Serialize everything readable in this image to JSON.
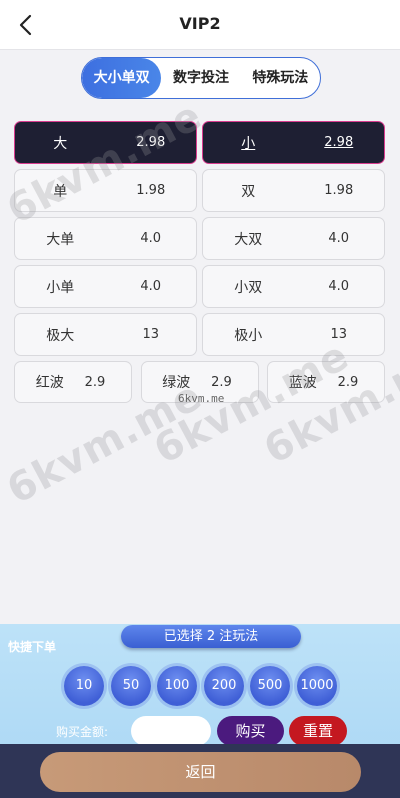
{
  "header": {
    "title": "VIP2"
  },
  "tabs": [
    {
      "label": "大小单双",
      "active": true
    },
    {
      "label": "数字投注",
      "active": false
    },
    {
      "label": "特殊玩法",
      "active": false
    }
  ],
  "odds": {
    "row1": [
      {
        "name": "大",
        "odd": "2.98"
      },
      {
        "name": "小",
        "odd": "2.98"
      }
    ],
    "row2": [
      {
        "name": "单",
        "odd": "1.98"
      },
      {
        "name": "双",
        "odd": "1.98"
      }
    ],
    "row3": [
      {
        "name": "大单",
        "odd": "4.0"
      },
      {
        "name": "大双",
        "odd": "4.0"
      }
    ],
    "row4": [
      {
        "name": "小单",
        "odd": "4.0"
      },
      {
        "name": "小双",
        "odd": "4.0"
      }
    ],
    "row5": [
      {
        "name": "极大",
        "odd": "13"
      },
      {
        "name": "极小",
        "odd": "13"
      }
    ],
    "row6": [
      {
        "name": "红波",
        "odd": "2.9"
      },
      {
        "name": "绿波",
        "odd": "2.9"
      },
      {
        "name": "蓝波",
        "odd": "2.9"
      }
    ]
  },
  "watermark": {
    "large": "6kvm.me",
    "small": "6kvm.me"
  },
  "bottom": {
    "selected_text": "已选择 2 注玩法",
    "quick_label": "快捷下单",
    "chips": [
      "10",
      "50",
      "100",
      "200",
      "500",
      "1000"
    ],
    "amount_label": "购买金额:",
    "amount_value": "",
    "buy_label": "购买",
    "reset_label": "重置",
    "return_label": "返回"
  },
  "colors": {
    "accent": "#3d6fe0",
    "selected_bg": "#1e1f33",
    "selected_border": "#d93c8f",
    "buy": "#4b1a7e",
    "reset": "#c41820",
    "footer": "#2f3556",
    "return": "#c79a78"
  }
}
